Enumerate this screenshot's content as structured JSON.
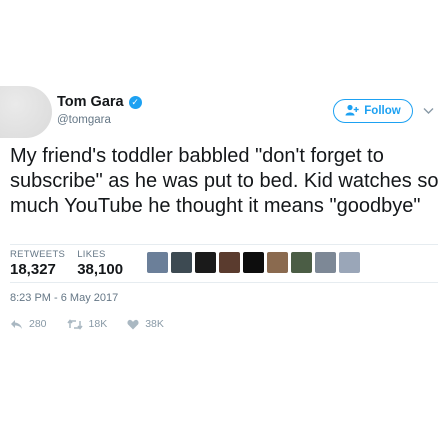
{
  "author": {
    "name": "Tom Gara",
    "handle": "@tomgara",
    "verified_icon": "verified-badge-icon"
  },
  "follow_button": {
    "label": "Follow",
    "icon": "add-user-icon"
  },
  "menu_icon": "chevron-down-icon",
  "tweet": {
    "text": "My friend's toddler babbled \"don't forget to subscribe\" as he was put to bed. Kid watches so much YouTube he thought it means \"goodbye\""
  },
  "stats": {
    "retweets_label": "RETWEETS",
    "retweets_value": "18,327",
    "likes_label": "LIKES",
    "likes_value": "38,100"
  },
  "likers": [
    {
      "name": "liker-avatar-1",
      "color": "#6b7f99"
    },
    {
      "name": "liker-avatar-2",
      "color": "#3d4a52"
    },
    {
      "name": "liker-avatar-3",
      "color": "#1a1a1a"
    },
    {
      "name": "liker-avatar-4",
      "color": "#5a3b2e"
    },
    {
      "name": "liker-avatar-5",
      "color": "#0d0d0d"
    },
    {
      "name": "liker-avatar-6",
      "color": "#8a6a4f"
    },
    {
      "name": "liker-avatar-7",
      "color": "#4b5d45"
    },
    {
      "name": "liker-avatar-8",
      "color": "#7d8896"
    },
    {
      "name": "liker-avatar-9",
      "color": "#9aa6b8"
    }
  ],
  "timestamp": "8:23 PM - 6 May 2017",
  "actions": {
    "reply_count": "280",
    "retweet_count": "18K",
    "like_count": "38K"
  },
  "colors": {
    "accent": "#1da1f2",
    "text": "#14171a",
    "muted": "#657786",
    "icon": "#8899a6"
  }
}
